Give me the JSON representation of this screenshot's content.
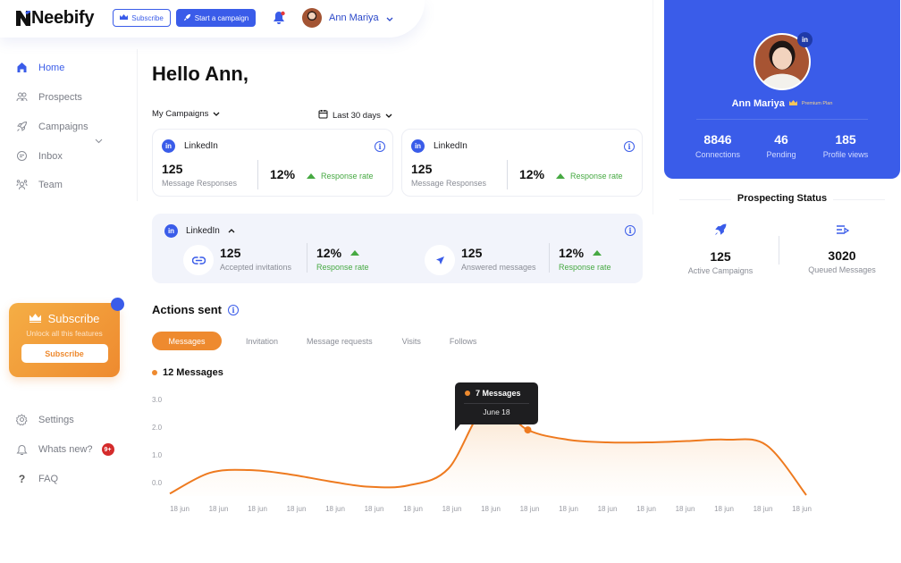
{
  "app": {
    "name": "Neebify"
  },
  "header": {
    "subscribe_label": "Subscribe",
    "start_campaign_label": "Start a campaign",
    "user_name": "Ann Mariya",
    "notification_dot": true
  },
  "sidebar": {
    "items": [
      {
        "label": "Home",
        "icon": "home-icon",
        "active": true
      },
      {
        "label": "Prospects",
        "icon": "users-icon"
      },
      {
        "label": "Campaigns",
        "icon": "rocket-icon",
        "expandable": true
      },
      {
        "label": "Inbox",
        "icon": "inbox-icon"
      },
      {
        "label": "Team",
        "icon": "team-icon"
      }
    ],
    "subscribe_card": {
      "title": "Subscribe",
      "subtitle": "Unlock all this features",
      "button": "Subscribe"
    },
    "bottom_items": [
      {
        "label": "Settings",
        "icon": "gear-icon"
      },
      {
        "label": "Whats new?",
        "icon": "bell-icon",
        "badge": "9+"
      },
      {
        "label": "FAQ",
        "icon": "question-icon"
      }
    ]
  },
  "main": {
    "greeting": "Hello Ann,",
    "campaign_filter": "My Campaigns",
    "date_filter": "Last 30 days",
    "cards": [
      {
        "platform": "LinkedIn",
        "value": "125",
        "label": "Message Responses",
        "percent": "12%",
        "rate_label": "Response rate"
      },
      {
        "platform": "LinkedIn",
        "value": "125",
        "label": "Message Responses",
        "percent": "12%",
        "rate_label": "Response rate"
      }
    ],
    "linkedin_panel": {
      "platform": "LinkedIn",
      "stats": [
        {
          "value": "125",
          "label": "Accepted invitations",
          "percent": "12%",
          "rate_label": "Response rate",
          "icon": "link-icon"
        },
        {
          "value": "125",
          "label": "Answered messages",
          "percent": "12%",
          "rate_label": "Response rate",
          "icon": "send-icon"
        }
      ]
    },
    "actions": {
      "title": "Actions sent",
      "tabs": [
        "Messages",
        "Invitation",
        "Message requests",
        "Visits",
        "Follows"
      ],
      "active_tab": 0,
      "legend": "12 Messages",
      "tooltip": {
        "value": "7 Messages",
        "date": "June 18"
      }
    }
  },
  "profile": {
    "name": "Ann Mariya",
    "plan": "Premium Plan",
    "stats": [
      {
        "value": "8846",
        "label": "Connections"
      },
      {
        "value": "46",
        "label": "Pending"
      },
      {
        "value": "185",
        "label": "Profile views"
      }
    ]
  },
  "prospecting": {
    "title": "Prospecting Status",
    "stats": [
      {
        "value": "125",
        "label": "Active Campaigns",
        "icon": "rocket-icon"
      },
      {
        "value": "3020",
        "label": "Queued Messages",
        "icon": "queue-icon"
      }
    ]
  },
  "colors": {
    "primary": "#3a5ce9",
    "accent_orange": "#ee8a2f",
    "success_green": "#46a942",
    "badge_red": "#d42b2b"
  },
  "chart_data": {
    "type": "area",
    "title": "",
    "series": [
      {
        "name": "Messages",
        "x": [
          0,
          1,
          2,
          3,
          4,
          5,
          6,
          7,
          8,
          9,
          10,
          11,
          12,
          13,
          14,
          15,
          16
        ],
        "values": [
          -0.4,
          0.35,
          0.45,
          0.3,
          0.05,
          -0.15,
          -0.1,
          0.5,
          2.85,
          1.9,
          1.55,
          1.45,
          1.45,
          1.5,
          1.55,
          1.35,
          -0.45
        ]
      }
    ],
    "categories": [
      "18 jun",
      "18 jun",
      "18 jun",
      "18 jun",
      "18 jun",
      "18 jun",
      "18 jun",
      "18 jun",
      "18 jun",
      "18 jun",
      "18 jun",
      "18 jun",
      "18 jun",
      "18 jun",
      "18 jun",
      "18 jun",
      "18 jun"
    ],
    "yticks": [
      "0.0",
      "1.0",
      "2.0",
      "3.0"
    ],
    "ylim": [
      -0.5,
      3.0
    ],
    "highlight_index": 9,
    "grid": false,
    "legend": "top-left"
  }
}
